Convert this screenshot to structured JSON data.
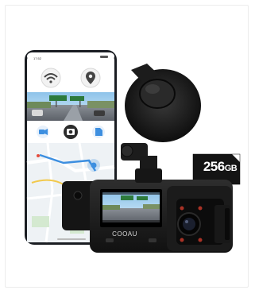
{
  "product": {
    "sd_card": {
      "capacity": "256",
      "unit": "GB"
    },
    "brand_label": "COOAU",
    "phone_status": {
      "time": "17:52"
    }
  },
  "colors": {
    "phone_body": "#1a1d22",
    "dashcam_body": "#1f1f1f",
    "app_accent": "#3d8fe0",
    "map_bg": "#eef2f5",
    "sd_card": "#141414"
  },
  "icons": [
    "wifi-icon",
    "gps-pin-icon",
    "video-icon",
    "camera-icon",
    "file-icon",
    "location-marker-icon"
  ]
}
